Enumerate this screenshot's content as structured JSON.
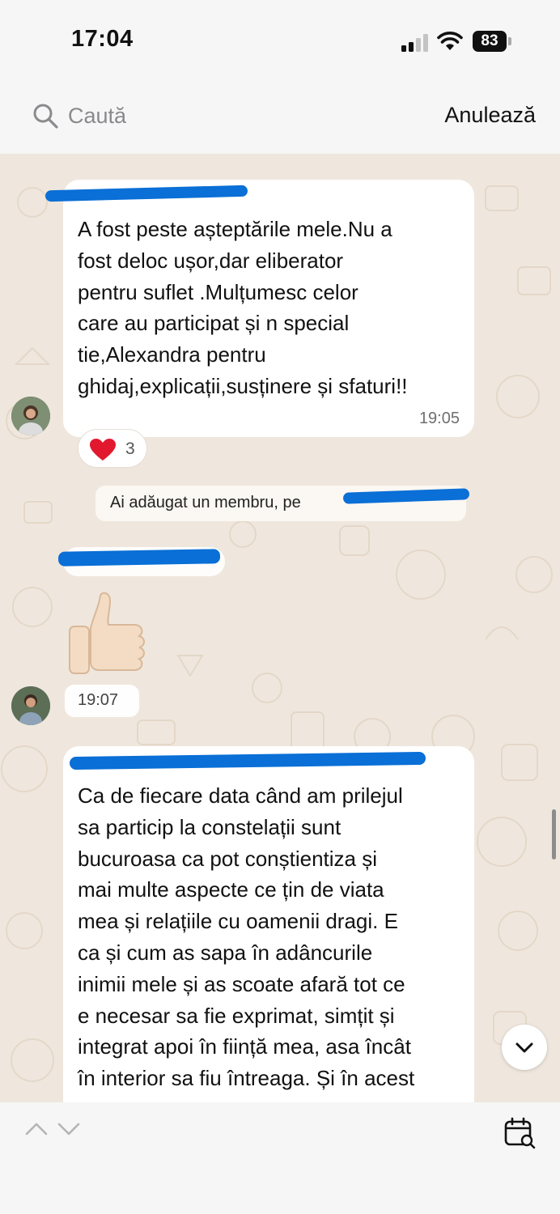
{
  "status_bar": {
    "time": "17:04",
    "battery": "83"
  },
  "search": {
    "placeholder": "Caută",
    "cancel_label": "Anulează"
  },
  "messages": [
    {
      "text": "A fost peste așteptările mele.Nu a\nfost deloc ușor,dar eliberator\npentru suflet .Mulțumesc celor\ncare au participat și n special\ntie,Alexandra pentru\nghidaj,explicații,susținere și sfaturi!!",
      "time": "19:05"
    },
    {
      "text": "",
      "time": "19:07",
      "emoji": "👍"
    },
    {
      "text": "Ca de fiecare data când am prilejul\nsa particip la constelații sunt\nbucuroasa ca pot conștientiza și\nmai multe aspecte ce țin de viata\nmea și relațiile cu oamenii dragi. E\nca și cum as sapa în adâncurile\ninimii mele și as scoate afară tot ce\ne necesar sa fie exprimat, simțit și\nintegrat apoi în ființă mea, asa încât\nîn interior sa fiu întreaga. Și în acest"
    }
  ],
  "reaction": {
    "emoji": "❤️",
    "count": "3"
  },
  "system_message": {
    "text": "Ai adăugat un membru, pe"
  },
  "colors": {
    "chat_background": "#efe7dd",
    "redaction": "#0a6fd6",
    "sender_pink": "#c2185b",
    "sender_green": "#1b8a4a"
  }
}
